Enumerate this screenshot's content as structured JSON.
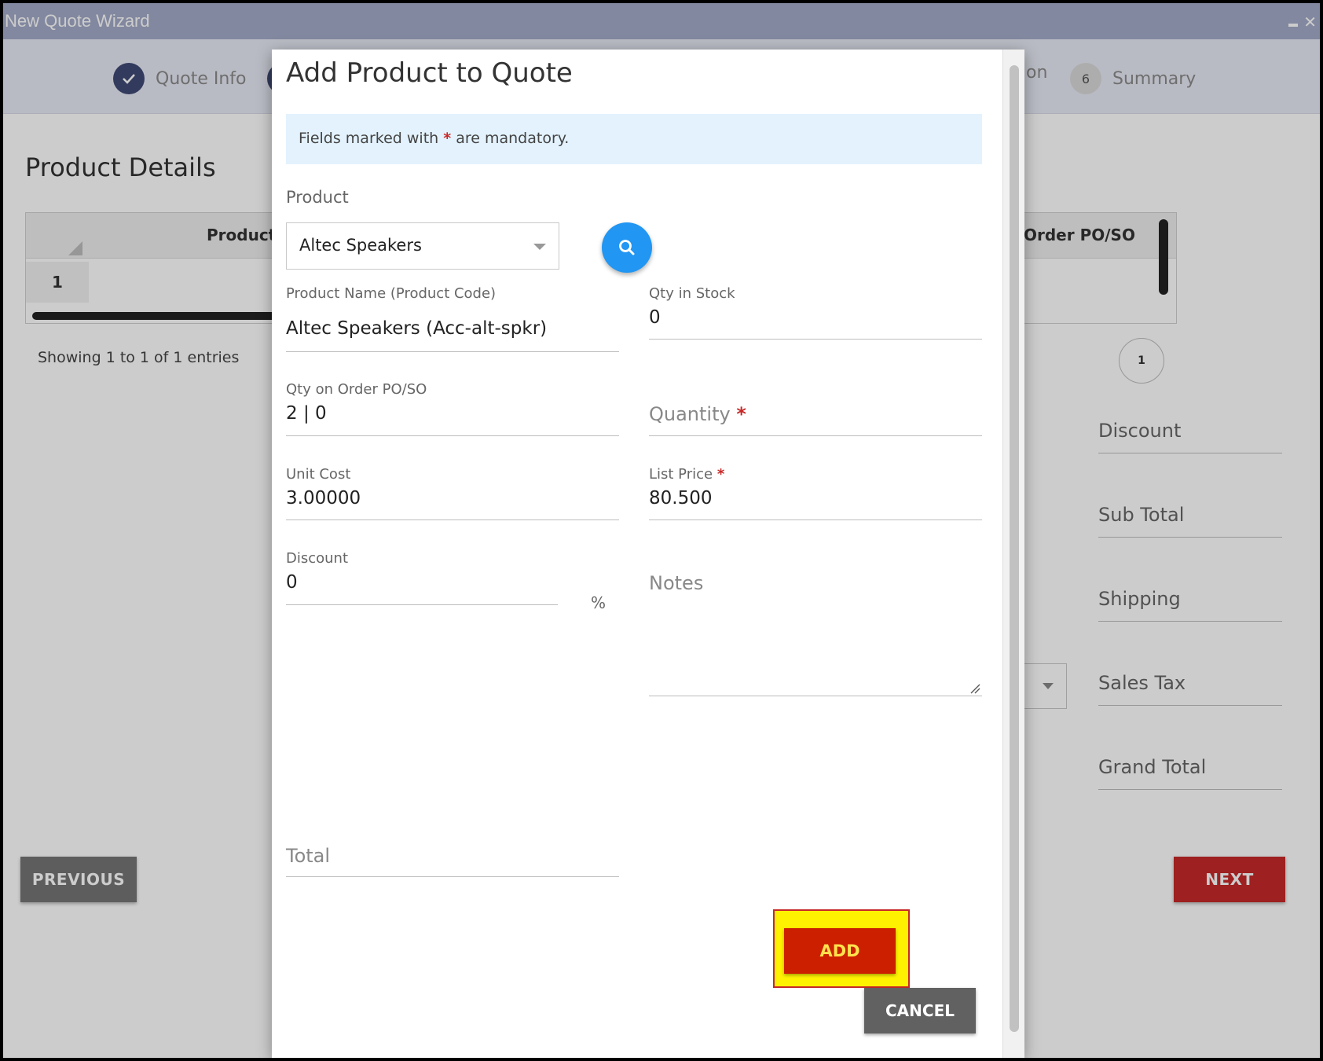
{
  "window": {
    "title": "New Quote Wizard"
  },
  "stepper": {
    "steps": [
      {
        "label": "Quote Info",
        "state": "done",
        "icon": "check-icon"
      },
      {
        "label": "on",
        "state": "partial"
      },
      {
        "number": "6",
        "label": "Summary",
        "state": "upcoming"
      }
    ]
  },
  "background": {
    "section_title": "Product Details",
    "table": {
      "columns": [
        "Product",
        "Order PO/SO"
      ],
      "rows": [
        {
          "number": "1"
        }
      ]
    },
    "showing": "Showing 1 to 1 of 1 entries",
    "pagination": {
      "current": "1"
    },
    "totals": [
      "Discount",
      "Sub Total",
      "Shipping",
      "Sales Tax",
      "Grand Total"
    ],
    "previous_label": "PREVIOUS",
    "next_label": "NEXT"
  },
  "modal": {
    "title": "Add Product to Quote",
    "notice_prefix": "Fields marked with",
    "notice_star": "*",
    "notice_suffix": "are mandatory.",
    "product": {
      "label": "Product",
      "selected": "Altec Speakers"
    },
    "fields": {
      "product_name_label": "Product Name (Product Code)",
      "product_name_value": "Altec Speakers (Acc-alt-spkr)",
      "qty_in_stock_label": "Qty in Stock",
      "qty_in_stock_value": "0",
      "qty_on_order_label": "Qty on Order PO/SO",
      "qty_on_order_value": "2 | 0",
      "quantity_placeholder": "Quantity",
      "unit_cost_label": "Unit Cost",
      "unit_cost_value": "3.00000",
      "list_price_label": "List Price",
      "list_price_value": "80.500",
      "discount_label": "Discount",
      "discount_value": "0",
      "discount_unit": "%",
      "notes_placeholder": "Notes",
      "total_placeholder": "Total"
    },
    "add_label": "ADD",
    "cancel_label": "CANCEL"
  },
  "colors": {
    "titlebar": "#a3aac7",
    "add_button": "#cc1f00",
    "add_highlight": "#fff200",
    "next_button": "#c62828",
    "search_button": "#2196f3"
  }
}
